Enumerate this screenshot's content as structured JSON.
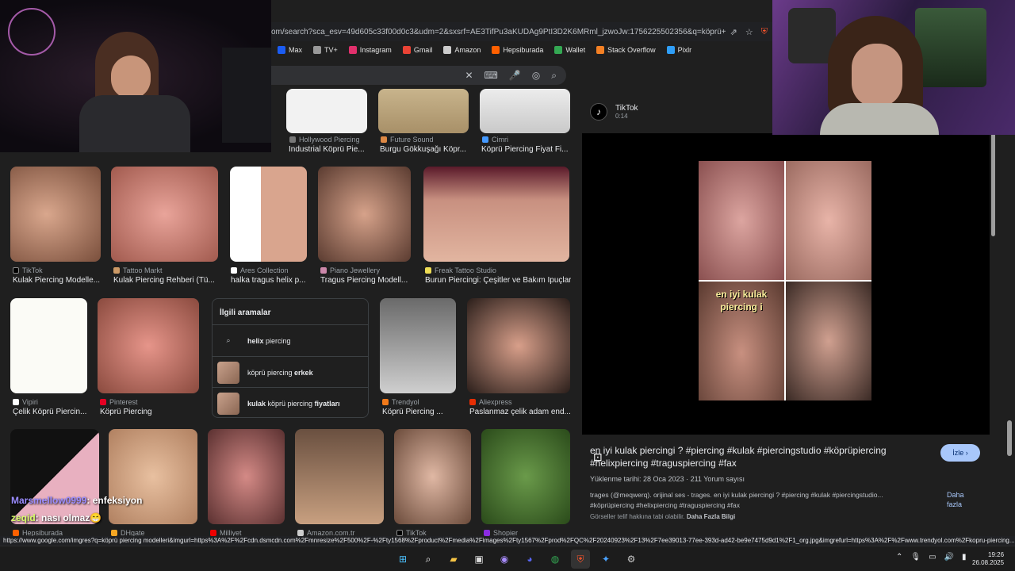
{
  "browser": {
    "url": "om/search?sca_esv=49d605c33f00d0c3&udm=2&sxsrf=AE3TifPu3aKUDAg9PtI3D2K6MRml_jzwoJw:1756225502356&q=köprü+piercing+mo...",
    "bookmarks": [
      {
        "label": "Max",
        "color": "#1b5cf2"
      },
      {
        "label": "TV+",
        "color": "#999999"
      },
      {
        "label": "Instagram",
        "color": "#e1306c"
      },
      {
        "label": "Gmail",
        "color": "#ea4335"
      },
      {
        "label": "Amazon",
        "color": "#cccccc"
      },
      {
        "label": "Hepsiburada",
        "color": "#ff6000"
      },
      {
        "label": "Wallet",
        "color": "#34a853"
      },
      {
        "label": "Stack Overflow",
        "color": "#f48024"
      },
      {
        "label": "Pixlr",
        "color": "#2f9ef7"
      }
    ]
  },
  "results": {
    "row1": [
      {
        "source": "Hollywood Piercing",
        "title": "Industrial Köprü Pie..."
      },
      {
        "source": "Future Sound",
        "title": "Burgu Gökkuşağı Köpr..."
      },
      {
        "source": "Cimri",
        "title": "Köprü Piercing Fiyat Fi..."
      }
    ],
    "row2": [
      {
        "source": "TikTok",
        "title": "Kulak Piercing Modelle..."
      },
      {
        "source": "Tattoo Markt",
        "title": "Kulak Piercing Rehberi (Tü..."
      },
      {
        "source": "Ares Collection",
        "title": "halka tragus helix p..."
      },
      {
        "source": "Piano Jewellery",
        "title": "Tragus Piercing Modell..."
      },
      {
        "source": "Freak Tattoo Studio",
        "title": "Burun Piercingi: Çeşitler ve Bakım İpuçları"
      }
    ],
    "row3": [
      {
        "source": "Vipiri",
        "title": "Çelik Köprü Piercin..."
      },
      {
        "source": "Pinterest",
        "title": "Köprü Piercing"
      },
      {
        "source": "Trendyol",
        "title": "Köprü Piercing ..."
      },
      {
        "source": "Aliexpress",
        "title": "Paslanmaz çelik adam end..."
      }
    ],
    "row4_sources": [
      "Hepsiburada",
      "DHgate",
      "Milliyet",
      "Amazon.com.tr",
      "TikTok",
      "Shopier"
    ]
  },
  "related": {
    "heading": "İlgili aramalar",
    "items": [
      {
        "bold": "helix",
        "rest": " piercing",
        "prefix": ""
      },
      {
        "prefix": "köprü piercing ",
        "bold": "erkek",
        "rest": ""
      },
      {
        "prefix": "",
        "bold": "kulak",
        "rest": " köprü piercing ",
        "bold2": "fiyatları"
      }
    ]
  },
  "preview": {
    "brand": "TikTok",
    "duration": "0:14",
    "overlay_text": "en iyi kulak piercing i",
    "title": "en iyi kulak piercingi ? #piercing #kulak #piercingstudio #köprüpiercing #helixpiercing #traguspiercing #fax",
    "visit_label": "İzle",
    "meta": "Yüklenme tarihi: 28 Oca 2023 · 211 Yorum sayısı",
    "description": "trages (@meqwerq). orijinal ses - trages. en iyi kulak piercingi ? #piercing #kulak #piercingstudio... #köprüpiercing #helixpiercing #traguspiercing #fax",
    "more_label": "Daha fazla",
    "copyright": "Görseller telif hakkına tabi olabilir.",
    "copyright_link": "Daha Fazla Bilgi"
  },
  "status_url": "https://www.google.com/imgres?q=köprü piercing modelleri&imgurl=https%3A%2F%2Fcdn.dsmcdn.com%2Fmnresize%2F500%2F-%2Fty1568%2Fproduct%2Fmedia%2Fimages%2Fty1567%2Fprod%2FQC%2F20240923%2F13%2F7ee39013-77ee-393d-ad42-be9e7475d9d1%2F1_org.jpg&imgrefurl=https%3A%2F%2Fwww.trendyol.com%2Fkopru-piercing...",
  "chat": [
    {
      "user": "Marsmellow0999",
      "message": ": enfeksiyon"
    },
    {
      "user": "zeqid",
      "message": ": nası olmaz😁"
    }
  ],
  "clock": {
    "time": "19:26",
    "date": "26.08.2025"
  }
}
